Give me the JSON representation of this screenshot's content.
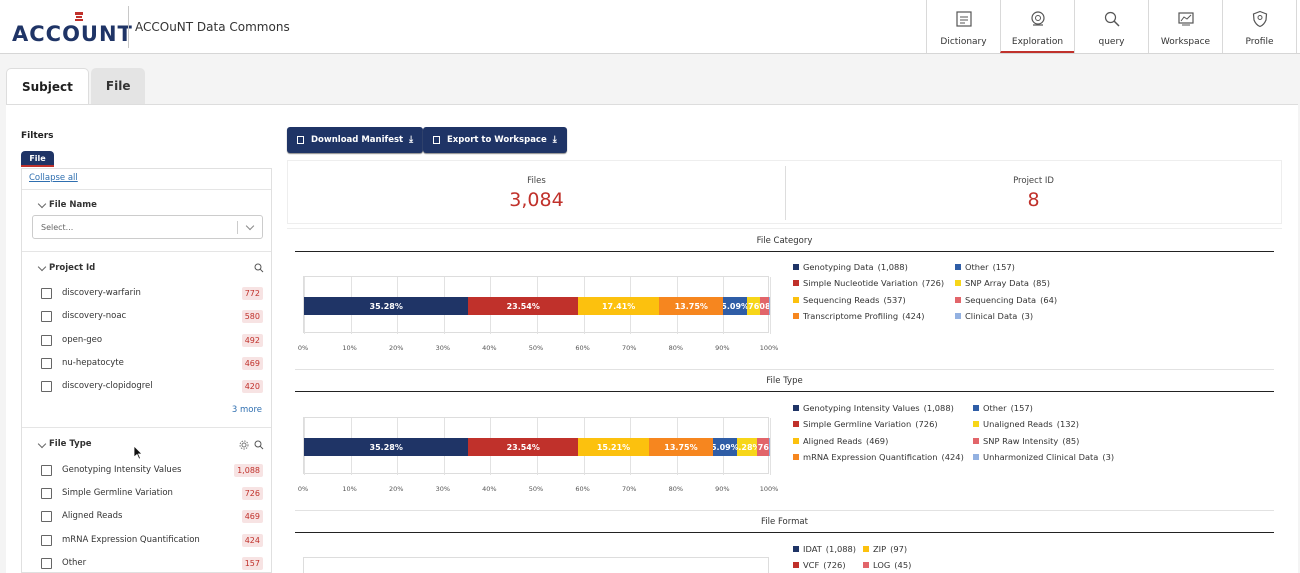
{
  "header": {
    "logo_text": "ACCOUNT",
    "app_title": "ACCOuNT Data Commons",
    "nav": [
      {
        "label": "Dictionary",
        "icon": "dictionary-icon",
        "active": false
      },
      {
        "label": "Exploration",
        "icon": "exploration-icon",
        "active": true
      },
      {
        "label": "query",
        "icon": "query-icon",
        "active": false
      },
      {
        "label": "Workspace",
        "icon": "workspace-icon",
        "active": false
      },
      {
        "label": "Profile",
        "icon": "profile-icon",
        "active": false
      }
    ]
  },
  "tabs": [
    {
      "label": "Subject",
      "active": true
    },
    {
      "label": "File",
      "active": false
    }
  ],
  "filters": {
    "title": "Filters",
    "tab_label": "File",
    "collapse_all": "Collapse all",
    "file_name": {
      "title": "File Name",
      "placeholder": "Select..."
    },
    "project_id": {
      "title": "Project Id",
      "options": [
        {
          "label": "discovery-warfarin",
          "count": "772"
        },
        {
          "label": "discovery-noac",
          "count": "580"
        },
        {
          "label": "open-geo",
          "count": "492"
        },
        {
          "label": "nu-hepatocyte",
          "count": "469"
        },
        {
          "label": "discovery-clopidogrel",
          "count": "420"
        }
      ],
      "more": "3 more"
    },
    "file_type": {
      "title": "File Type",
      "options": [
        {
          "label": "Genotyping Intensity Values",
          "count": "1,088"
        },
        {
          "label": "Simple Germline Variation",
          "count": "726"
        },
        {
          "label": "Aligned Reads",
          "count": "469"
        },
        {
          "label": "mRNA Expression Quantification",
          "count": "424"
        },
        {
          "label": "Other",
          "count": "157"
        }
      ]
    }
  },
  "actions": {
    "download_manifest": "Download Manifest",
    "export_workspace": "Export to Workspace"
  },
  "summary": {
    "files_label": "Files",
    "files_value": "3,084",
    "project_label": "Project ID",
    "project_value": "8"
  },
  "colors": {
    "navy": "#1f3466",
    "red": "#c0312b",
    "yellow": "#fcc10e",
    "orange": "#f6861f",
    "blue": "#2f5da6",
    "gold": "#f7d619",
    "salmon": "#e2656a",
    "lightblue": "#93b1e1"
  },
  "ticks": [
    "0%",
    "10%",
    "20%",
    "30%",
    "40%",
    "50%",
    "60%",
    "70%",
    "80%",
    "90%",
    "100%"
  ],
  "chart_data": [
    {
      "type": "bar",
      "title": "File Category",
      "orientation": "horizontal-stacked-percent",
      "xlim": [
        0,
        100
      ],
      "series": [
        {
          "name": "Genotyping Data",
          "value": 1088,
          "percent": 35.28,
          "label": "35.28%",
          "count_label": "(1,088)",
          "color": "#1f3466"
        },
        {
          "name": "Simple Nucleotide Variation",
          "value": 726,
          "percent": 23.54,
          "label": "23.54%",
          "count_label": "(726)",
          "color": "#c0312b"
        },
        {
          "name": "Sequencing Reads",
          "value": 537,
          "percent": 17.41,
          "label": "17.41%",
          "count_label": "(537)",
          "color": "#fcc10e"
        },
        {
          "name": "Transcriptome Profiling",
          "value": 424,
          "percent": 13.75,
          "label": "13.75%",
          "count_label": "(424)",
          "color": "#f6861f"
        },
        {
          "name": "Other",
          "value": 157,
          "percent": 5.09,
          "label": "5.09%",
          "count_label": "(157)",
          "color": "#2f5da6"
        },
        {
          "name": "SNP Array Data",
          "value": 85,
          "percent": 2.76,
          "label": "2.76%",
          "count_label": "(85)",
          "color": "#f7d619"
        },
        {
          "name": "Sequencing Data",
          "value": 64,
          "percent": 2.08,
          "label": "2.08%",
          "count_label": "(64)",
          "color": "#e2656a"
        },
        {
          "name": "Clinical Data",
          "value": 3,
          "percent": 0.1,
          "label": "",
          "count_label": "(3)",
          "color": "#93b1e1"
        }
      ]
    },
    {
      "type": "bar",
      "title": "File Type",
      "orientation": "horizontal-stacked-percent",
      "xlim": [
        0,
        100
      ],
      "series": [
        {
          "name": "Genotyping Intensity Values",
          "value": 1088,
          "percent": 35.28,
          "label": "35.28%",
          "count_label": "(1,088)",
          "color": "#1f3466"
        },
        {
          "name": "Simple Germline Variation",
          "value": 726,
          "percent": 23.54,
          "label": "23.54%",
          "count_label": "(726)",
          "color": "#c0312b"
        },
        {
          "name": "Aligned Reads",
          "value": 469,
          "percent": 15.21,
          "label": "15.21%",
          "count_label": "(469)",
          "color": "#fcc10e"
        },
        {
          "name": "mRNA Expression Quantification",
          "value": 424,
          "percent": 13.75,
          "label": "13.75%",
          "count_label": "(424)",
          "color": "#f6861f"
        },
        {
          "name": "Other",
          "value": 157,
          "percent": 5.09,
          "label": "5.09%",
          "count_label": "(157)",
          "color": "#2f5da6"
        },
        {
          "name": "Unaligned Reads",
          "value": 132,
          "percent": 4.28,
          "label": "4.28%",
          "count_label": "(132)",
          "color": "#f7d619"
        },
        {
          "name": "SNP Raw Intensity",
          "value": 85,
          "percent": 2.76,
          "label": "2.76%",
          "count_label": "(85)",
          "color": "#e2656a"
        },
        {
          "name": "Unharmonized Clinical Data",
          "value": 3,
          "percent": 0.1,
          "label": "",
          "count_label": "(3)",
          "color": "#93b1e1"
        }
      ]
    },
    {
      "type": "bar",
      "title": "File Format",
      "orientation": "horizontal-stacked-percent",
      "series": [
        {
          "name": "IDAT",
          "value": 1088,
          "count_label": "(1,088)",
          "color": "#1f3466"
        },
        {
          "name": "ZIP",
          "value": 97,
          "count_label": "(97)",
          "color": "#fcc10e"
        },
        {
          "name": "VCF",
          "value": 726,
          "count_label": "(726)",
          "color": "#c0312b"
        },
        {
          "name": "LOG",
          "value": 45,
          "count_label": "(45)",
          "color": "#e2656a"
        }
      ]
    }
  ]
}
